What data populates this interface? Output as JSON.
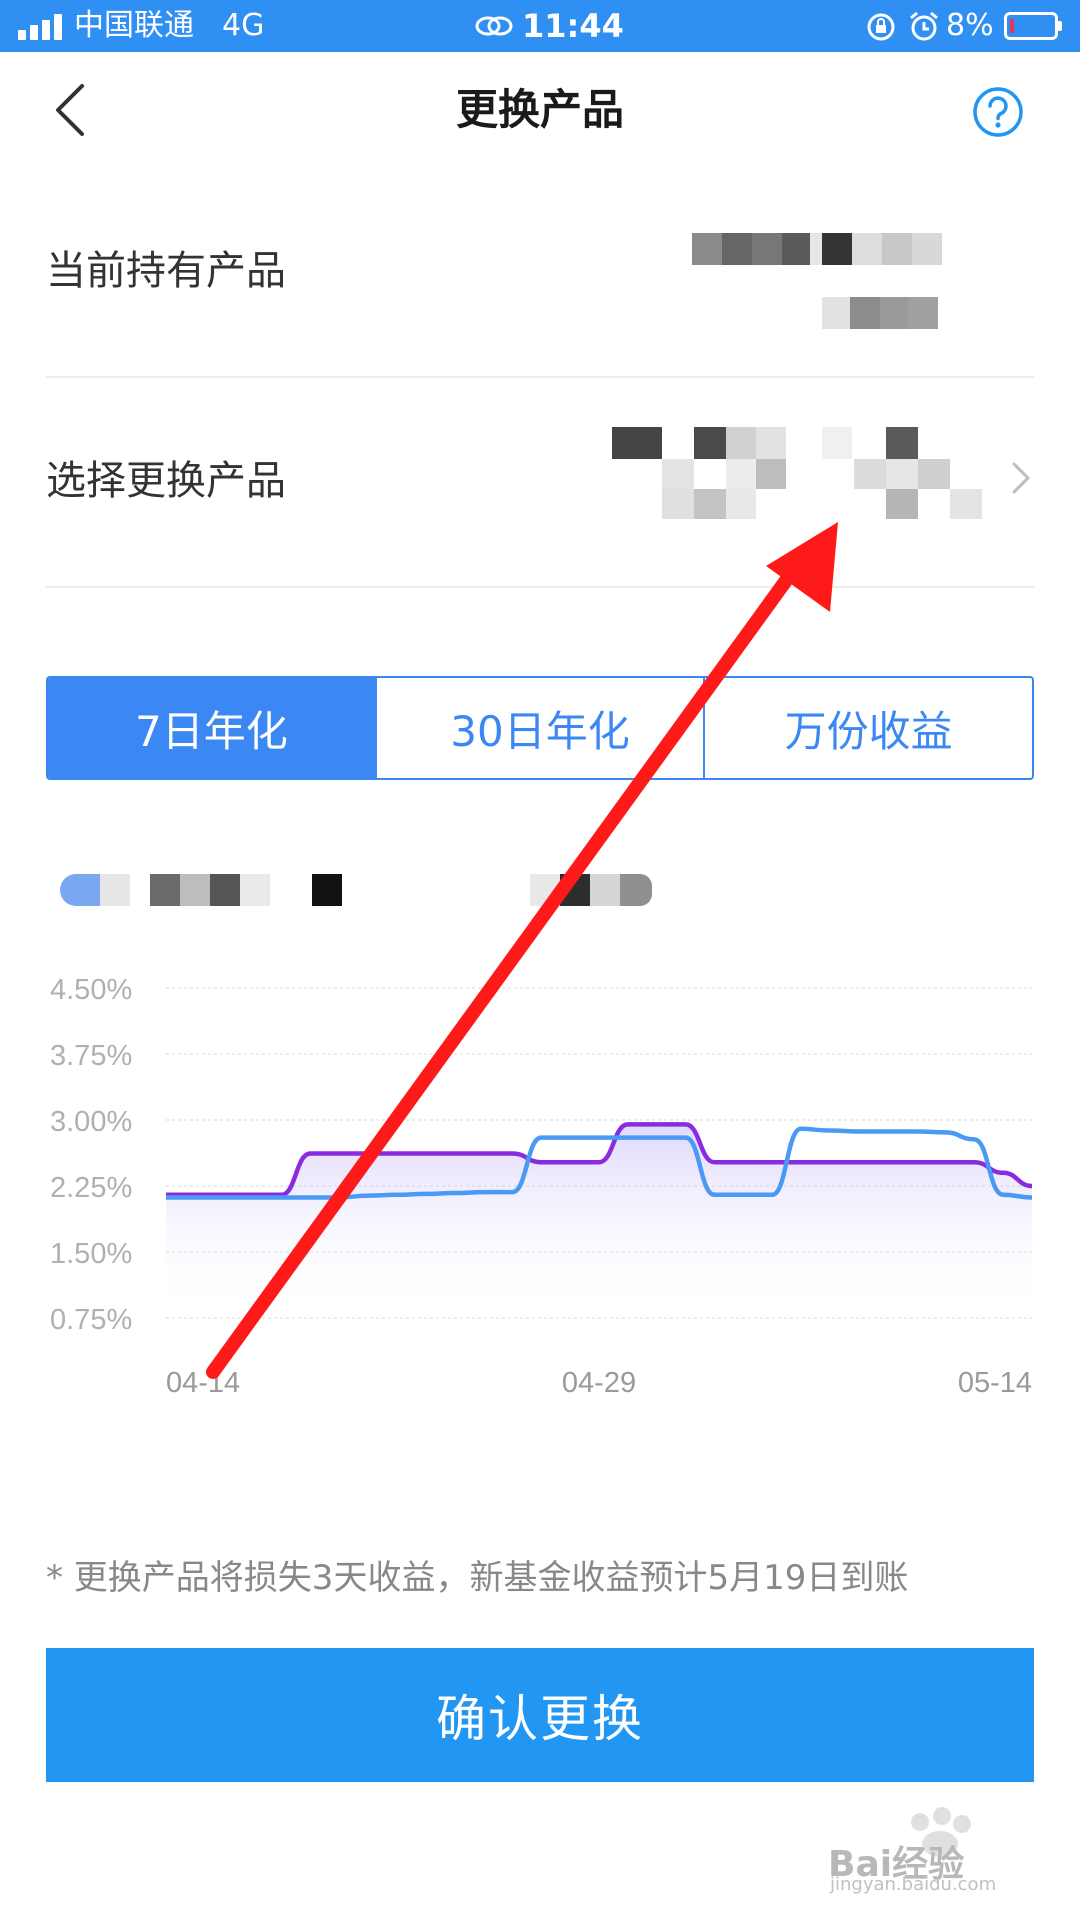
{
  "status_bar": {
    "carrier": "中国联通",
    "network": "4G",
    "time": "11:44",
    "battery_percent": "8%",
    "battery_level": 0.08,
    "icons": [
      "signal-icon",
      "link-icon",
      "rotation-lock-icon",
      "alarm-icon",
      "battery-icon"
    ]
  },
  "nav": {
    "title": "更换产品",
    "back_icon": "chevron-left-icon",
    "help_icon": "help-circle-icon"
  },
  "rows": {
    "current_label": "当前持有产品",
    "select_label": "选择更换产品"
  },
  "tabs": [
    {
      "label": "7日年化",
      "active": true
    },
    {
      "label": "30日年化",
      "active": false
    },
    {
      "label": "万份收益",
      "active": false
    }
  ],
  "chart_data": {
    "type": "line",
    "y_tick_labels": [
      "4.50%",
      "3.75%",
      "3.00%",
      "2.25%",
      "1.50%",
      "0.75%"
    ],
    "x_tick_labels": [
      "04-14",
      "04-29",
      "05-14"
    ],
    "ylim": [
      0.75,
      4.5
    ],
    "grid": true,
    "x": [
      0,
      1,
      2,
      3,
      4,
      5,
      6,
      7,
      8,
      9,
      10,
      11,
      12,
      13,
      14,
      15,
      16,
      17,
      18,
      19,
      20,
      21,
      22,
      23,
      24,
      25,
      26,
      27,
      28,
      29,
      30
    ],
    "series": [
      {
        "color": "#8a2be2",
        "values": [
          2.15,
          2.15,
          2.15,
          2.15,
          2.15,
          2.62,
          2.62,
          2.62,
          2.62,
          2.62,
          2.62,
          2.62,
          2.62,
          2.52,
          2.52,
          2.52,
          2.95,
          2.95,
          2.95,
          2.52,
          2.52,
          2.52,
          2.52,
          2.52,
          2.52,
          2.52,
          2.52,
          2.52,
          2.52,
          2.4,
          2.25
        ]
      },
      {
        "color": "#4a9af5",
        "values": [
          2.12,
          2.12,
          2.12,
          2.12,
          2.12,
          2.12,
          2.12,
          2.14,
          2.15,
          2.16,
          2.17,
          2.18,
          2.18,
          2.8,
          2.8,
          2.8,
          2.8,
          2.8,
          2.8,
          2.15,
          2.15,
          2.15,
          2.9,
          2.88,
          2.87,
          2.87,
          2.87,
          2.86,
          2.78,
          2.15,
          2.12
        ]
      }
    ]
  },
  "footer": {
    "note": "* 更换产品将损失3天收益，新基金收益预计5月19日到账",
    "confirm_label": "确认更换"
  },
  "watermark": {
    "text": "Bai经验",
    "url": "jingyan.baidu.com"
  },
  "colors": {
    "status_bar": "#2f8ff3",
    "accent": "#3b88f5",
    "confirm_button": "#2196f3",
    "annotation_arrow": "#ff1a1a"
  }
}
